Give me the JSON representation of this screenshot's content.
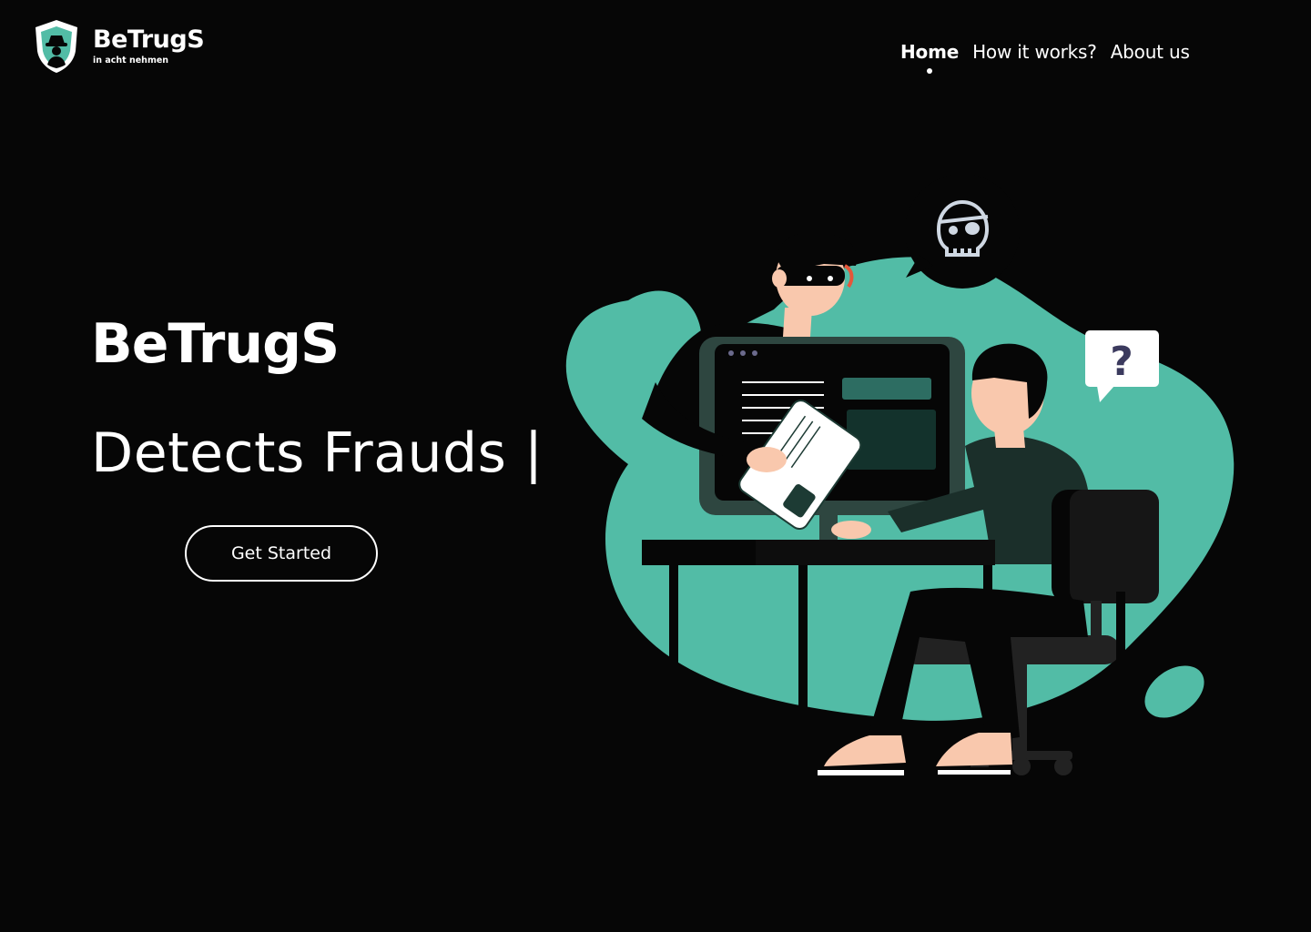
{
  "brand": {
    "name": "BeTrugS",
    "tagline": "in acht nehmen",
    "logo_icon": "shield-spy-icon"
  },
  "nav": {
    "items": [
      {
        "label": "Home",
        "active": true
      },
      {
        "label": "How it works?",
        "active": false
      },
      {
        "label": "About us",
        "active": false
      }
    ]
  },
  "hero": {
    "title": "BeTrugS",
    "subtitle": "Detects Frauds |",
    "cta_label": "Get Started"
  },
  "illustration": {
    "bubble_icons": [
      "skull-eyepatch-icon",
      "question-mark-icon"
    ],
    "bubble_question_text": "?"
  },
  "colors": {
    "background": "#060606",
    "accent": "#52bca6",
    "dark_green": "#1d3b34",
    "text": "#ffffff"
  }
}
